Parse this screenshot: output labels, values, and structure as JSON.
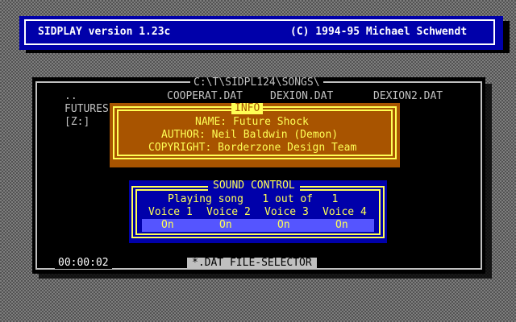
{
  "title_bar": {
    "app_title": "SIDPLAY version 1.23c",
    "copyright": "(C) 1994-95 Michael Schwendt"
  },
  "file_selector": {
    "path": "C:\\T\\SIDPL124\\SONGS\\",
    "entries": {
      "parent_dir": "..",
      "futures": "FUTURES",
      "drive": "[Z:]",
      "cooperat": "COOPERAT.DAT",
      "dexion": "DEXION.DAT",
      "dexion2": "DEXION2.DAT"
    },
    "time": "00:00:02",
    "label": "*.DAT FILE-SELECTOR"
  },
  "info": {
    "title": "INFO",
    "name": "NAME: Future Shock",
    "author": "AUTHOR: Neil Baldwin (Demon)",
    "copyright": "COPYRIGHT: Borderzone Design Team"
  },
  "sound_control": {
    "title": "SOUND CONTROL",
    "playing": "Playing song   1 out of   1",
    "voices": [
      "Voice 1",
      "Voice 2",
      "Voice 3",
      "Voice 4"
    ],
    "voice_states": [
      "On",
      "On",
      "On",
      "On"
    ]
  },
  "colors": {
    "title_bar_bg": "#0000aa",
    "info_bg": "#a85400",
    "info_text": "#ffff55",
    "sound_control_bg": "#0000aa",
    "voice_bar_bg": "#5555ff"
  }
}
